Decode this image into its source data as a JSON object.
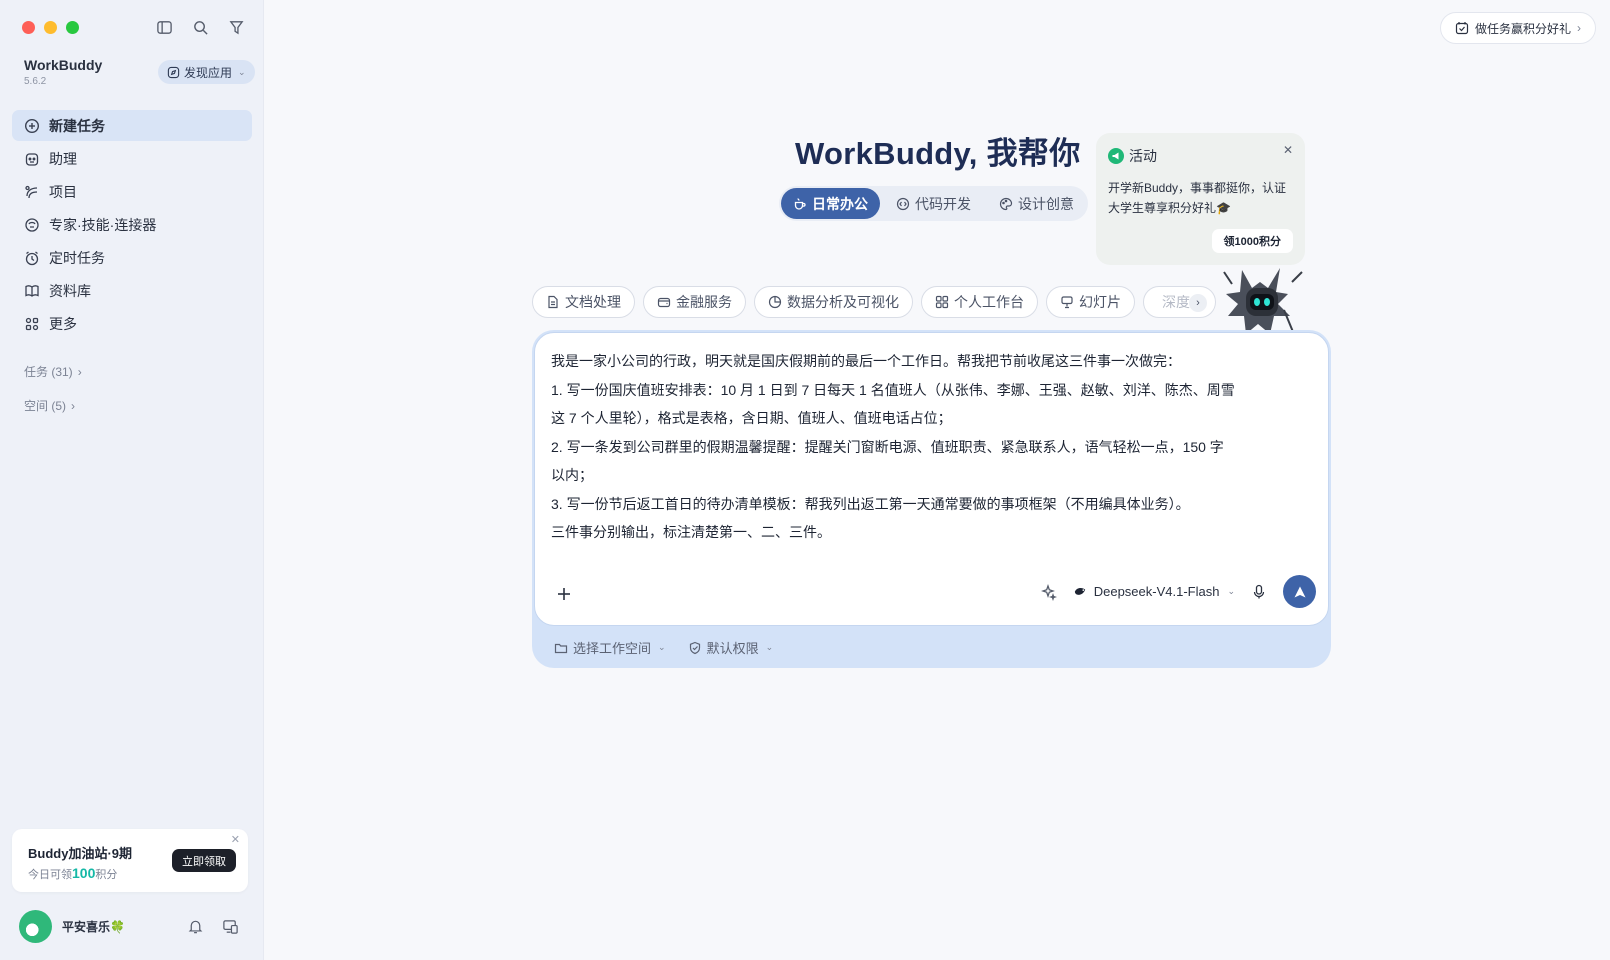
{
  "sidebar": {
    "brand_name": "WorkBuddy",
    "version": "5.6.2",
    "discover_label": "发现应用",
    "nav": [
      {
        "label": "新建任务",
        "icon": "plus-circle-icon",
        "active": true
      },
      {
        "label": "助理",
        "icon": "assistant-icon"
      },
      {
        "label": "项目",
        "icon": "project-icon"
      },
      {
        "label": "专家·技能·连接器",
        "icon": "expert-icon"
      },
      {
        "label": "定时任务",
        "icon": "alarm-clock-icon"
      },
      {
        "label": "资料库",
        "icon": "book-icon"
      },
      {
        "label": "更多",
        "icon": "grid-more-icon"
      }
    ],
    "tasks_group": "任务 (31)",
    "spaces_group": "空间 (5)",
    "promo": {
      "title": "Buddy加油站·9期",
      "sub_prefix": "今日可领",
      "sub_num": "100",
      "sub_suffix": "积分",
      "button": "立即领取"
    },
    "user_name": "平安喜乐🍀"
  },
  "header": {
    "reward_label": "做任务赢积分好礼"
  },
  "main": {
    "title": "WorkBuddy, 我帮你",
    "modes": [
      {
        "label": "日常办公",
        "active": true
      },
      {
        "label": "代码开发"
      },
      {
        "label": "设计创意"
      }
    ],
    "activity": {
      "title": "活动",
      "body": "开学新Buddy，事事都挺你，认证大学生尊享积分好礼🎓",
      "button": "领1000积分"
    },
    "chips": [
      "文档处理",
      "金融服务",
      "数据分析及可视化",
      "个人工作台",
      "幻灯片",
      "深度"
    ],
    "prompt_lines": [
      "我是一家小公司的行政，明天就是国庆假期前的最后一个工作日。帮我把节前收尾这三件事一次做完：",
      "1. 写一份国庆值班安排表：10 月 1 日到 7 日每天 1 名值班人（从张伟、李娜、王强、赵敏、刘洋、陈杰、周雪",
      "这 7 个人里轮），格式是表格，含日期、值班人、值班电话占位；",
      "2. 写一条发到公司群里的假期温馨提醒：提醒关门窗断电源、值班职责、紧急联系人，语气轻松一点，150 字",
      "以内；",
      "3. 写一份节后返工首日的待办清单模板：帮我列出返工第一天通常要做的事项框架（不用编具体业务）。",
      "三件事分别输出，标注清楚第一、二、三件。"
    ],
    "model": "Deepseek-V4.1-Flash",
    "workspace_label": "选择工作空间",
    "permission_label": "默认权限"
  },
  "colors": {
    "accent": "#3e63a8",
    "sidebar_bg": "#eef1f8",
    "activity_green": "#1fb877"
  }
}
